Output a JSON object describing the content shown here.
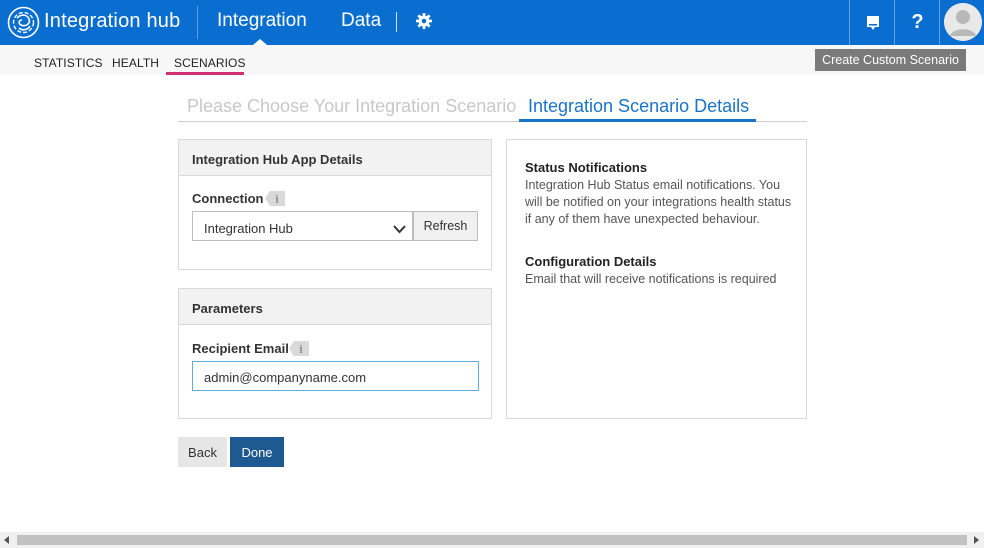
{
  "header": {
    "app_title": "Integration hub",
    "nav": [
      {
        "label": "Integration",
        "active": true
      },
      {
        "label": "Data",
        "active": false
      }
    ],
    "icons": [
      "logo-icon",
      "gear-icon",
      "notifications-icon",
      "help-icon",
      "user-avatar-icon"
    ],
    "help_glyph": "?",
    "colors": {
      "bar": "#0a6ed1"
    }
  },
  "subnav": {
    "tabs": [
      {
        "label": "STATISTICS",
        "active": false
      },
      {
        "label": "HEALTH",
        "active": false
      },
      {
        "label": "SCENARIOS",
        "active": true
      }
    ],
    "active_underline_color": "#d0306f",
    "create_button": "Create Custom Scenario"
  },
  "wizard": {
    "steps": [
      {
        "label": "Please Choose Your Integration Scenario",
        "active": false
      },
      {
        "label": "Integration Scenario Details",
        "active": true
      }
    ]
  },
  "app_details": {
    "title": "Integration Hub App Details",
    "connection_label": "Connection",
    "connection_value": "Integration Hub",
    "refresh_label": "Refresh"
  },
  "parameters": {
    "title": "Parameters",
    "email_label": "Recipient Email",
    "email_value": "admin@companyname.com"
  },
  "details": {
    "status_title": "Status Notifications",
    "status_text": "Integration Hub Status email notifications. You will be notified on your integrations health status if any of them have unexpected behaviour.",
    "config_title": "Configuration Details",
    "config_text": "Email that will receive notifications is required"
  },
  "actions": {
    "back": "Back",
    "done": "Done"
  }
}
